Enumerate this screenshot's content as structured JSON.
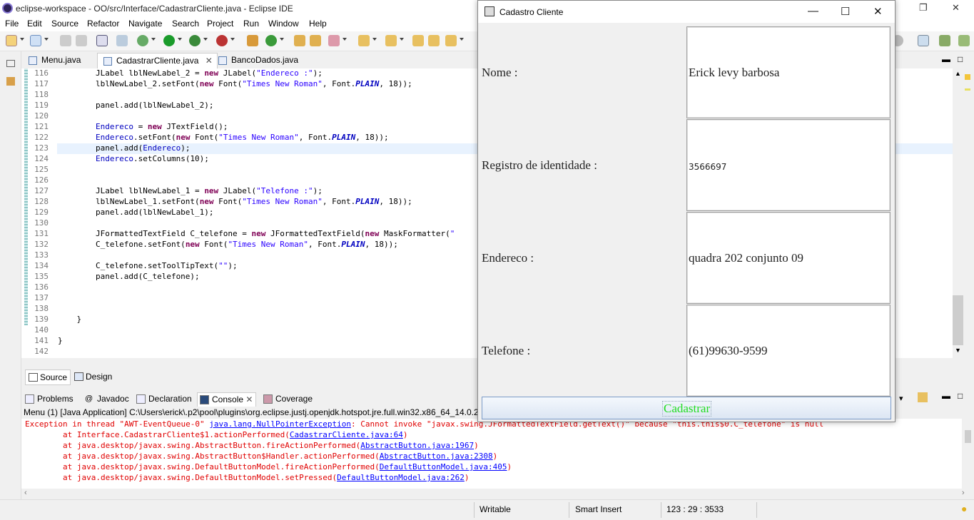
{
  "window": {
    "title": "eclipse-workspace - OO/src/Interface/CadastrarCliente.java - Eclipse IDE"
  },
  "menu": [
    "File",
    "Edit",
    "Source",
    "Refactor",
    "Navigate",
    "Search",
    "Project",
    "Run",
    "Window",
    "Help"
  ],
  "editor_tabs": [
    {
      "label": "Menu.java"
    },
    {
      "label": "CadastrarCliente.java",
      "close": "✕"
    },
    {
      "label": "BancoDados.java"
    }
  ],
  "code_lines": [
    {
      "n": "116",
      "t": "        JLabel lblNewLabel_2 = new JLabel(\"Endereco :\");"
    },
    {
      "n": "117",
      "t": "        lblNewLabel_2.setFont(new Font(\"Times New Roman\", Font.PLAIN, 18));"
    },
    {
      "n": "118",
      "t": ""
    },
    {
      "n": "119",
      "t": "        panel.add(lblNewLabel_2);"
    },
    {
      "n": "120",
      "t": ""
    },
    {
      "n": "121",
      "t": "        Endereco = new JTextField();"
    },
    {
      "n": "122",
      "t": "        Endereco.setFont(new Font(\"Times New Roman\", Font.PLAIN, 18));"
    },
    {
      "n": "123",
      "t": "        panel.add(Endereco);"
    },
    {
      "n": "124",
      "t": "        Endereco.setColumns(10);"
    },
    {
      "n": "125",
      "t": ""
    },
    {
      "n": "126",
      "t": ""
    },
    {
      "n": "127",
      "t": "        JLabel lblNewLabel_1 = new JLabel(\"Telefone :\");"
    },
    {
      "n": "128",
      "t": "        lblNewLabel_1.setFont(new Font(\"Times New Roman\", Font.PLAIN, 18));"
    },
    {
      "n": "129",
      "t": "        panel.add(lblNewLabel_1);"
    },
    {
      "n": "130",
      "t": ""
    },
    {
      "n": "131",
      "t": "        JFormattedTextField C_telefone = new JFormattedTextField(new MaskFormatter(\""
    },
    {
      "n": "132",
      "t": "        C_telefone.setFont(new Font(\"Times New Roman\", Font.PLAIN, 18));"
    },
    {
      "n": "133",
      "t": ""
    },
    {
      "n": "134",
      "t": "        C_telefone.setToolTipText(\"\");"
    },
    {
      "n": "135",
      "t": "        panel.add(C_telefone);"
    },
    {
      "n": "136",
      "t": ""
    },
    {
      "n": "137",
      "t": ""
    },
    {
      "n": "138",
      "t": ""
    },
    {
      "n": "139",
      "t": "    }"
    },
    {
      "n": "140",
      "t": ""
    },
    {
      "n": "141",
      "t": "}"
    },
    {
      "n": "142",
      "t": ""
    }
  ],
  "source_design": {
    "source": "Source",
    "design": "Design"
  },
  "bottom_tabs": [
    "Problems",
    "Javadoc",
    "Declaration",
    "Console",
    "Coverage"
  ],
  "console_header": "Menu (1) [Java Application] C:\\Users\\erick\\.p2\\pool\\plugins\\org.eclipse.justj.openjdk.hotspot.jre.full.win32.x86_64_14.0.2",
  "console_lines": [
    {
      "pre": "Exception in thread \"AWT-EventQueue-0\" ",
      "link": "java.lang.NullPointerException",
      "post": ": Cannot invoke \"javax.swing.JFormattedTextField.getText()\" because \"this.this$0.C_telefone\" is null"
    },
    {
      "pre": "\tat Interface.CadastrarCliente$1.actionPerformed(",
      "link": "CadastrarCliente.java:64",
      "post": ")"
    },
    {
      "pre": "\tat java.desktop/javax.swing.AbstractButton.fireActionPerformed(",
      "link": "AbstractButton.java:1967",
      "post": ")"
    },
    {
      "pre": "\tat java.desktop/javax.swing.AbstractButton$Handler.actionPerformed(",
      "link": "AbstractButton.java:2308",
      "post": ")"
    },
    {
      "pre": "\tat java.desktop/javax.swing.DefaultButtonModel.fireActionPerformed(",
      "link": "DefaultButtonModel.java:405",
      "post": ")"
    },
    {
      "pre": "\tat java.desktop/javax.swing.DefaultButtonModel.setPressed(",
      "link": "DefaultButtonModel.java:262",
      "post": ")"
    }
  ],
  "status": {
    "writable": "Writable",
    "insert": "Smart Insert",
    "position": "123 : 29 : 3533"
  },
  "dialog": {
    "title": "Cadastro Cliente",
    "fields": [
      {
        "label": "Nome :",
        "value": "Erick levy barbosa"
      },
      {
        "label": "Registro de identidade :",
        "value": "3566697"
      },
      {
        "label": "Endereco :",
        "value": "quadra 202 conjunto 09"
      },
      {
        "label": "Telefone :",
        "value": "(61)99630-9599"
      }
    ],
    "button": "Cadastrar",
    "button_color": "#22dd22"
  }
}
